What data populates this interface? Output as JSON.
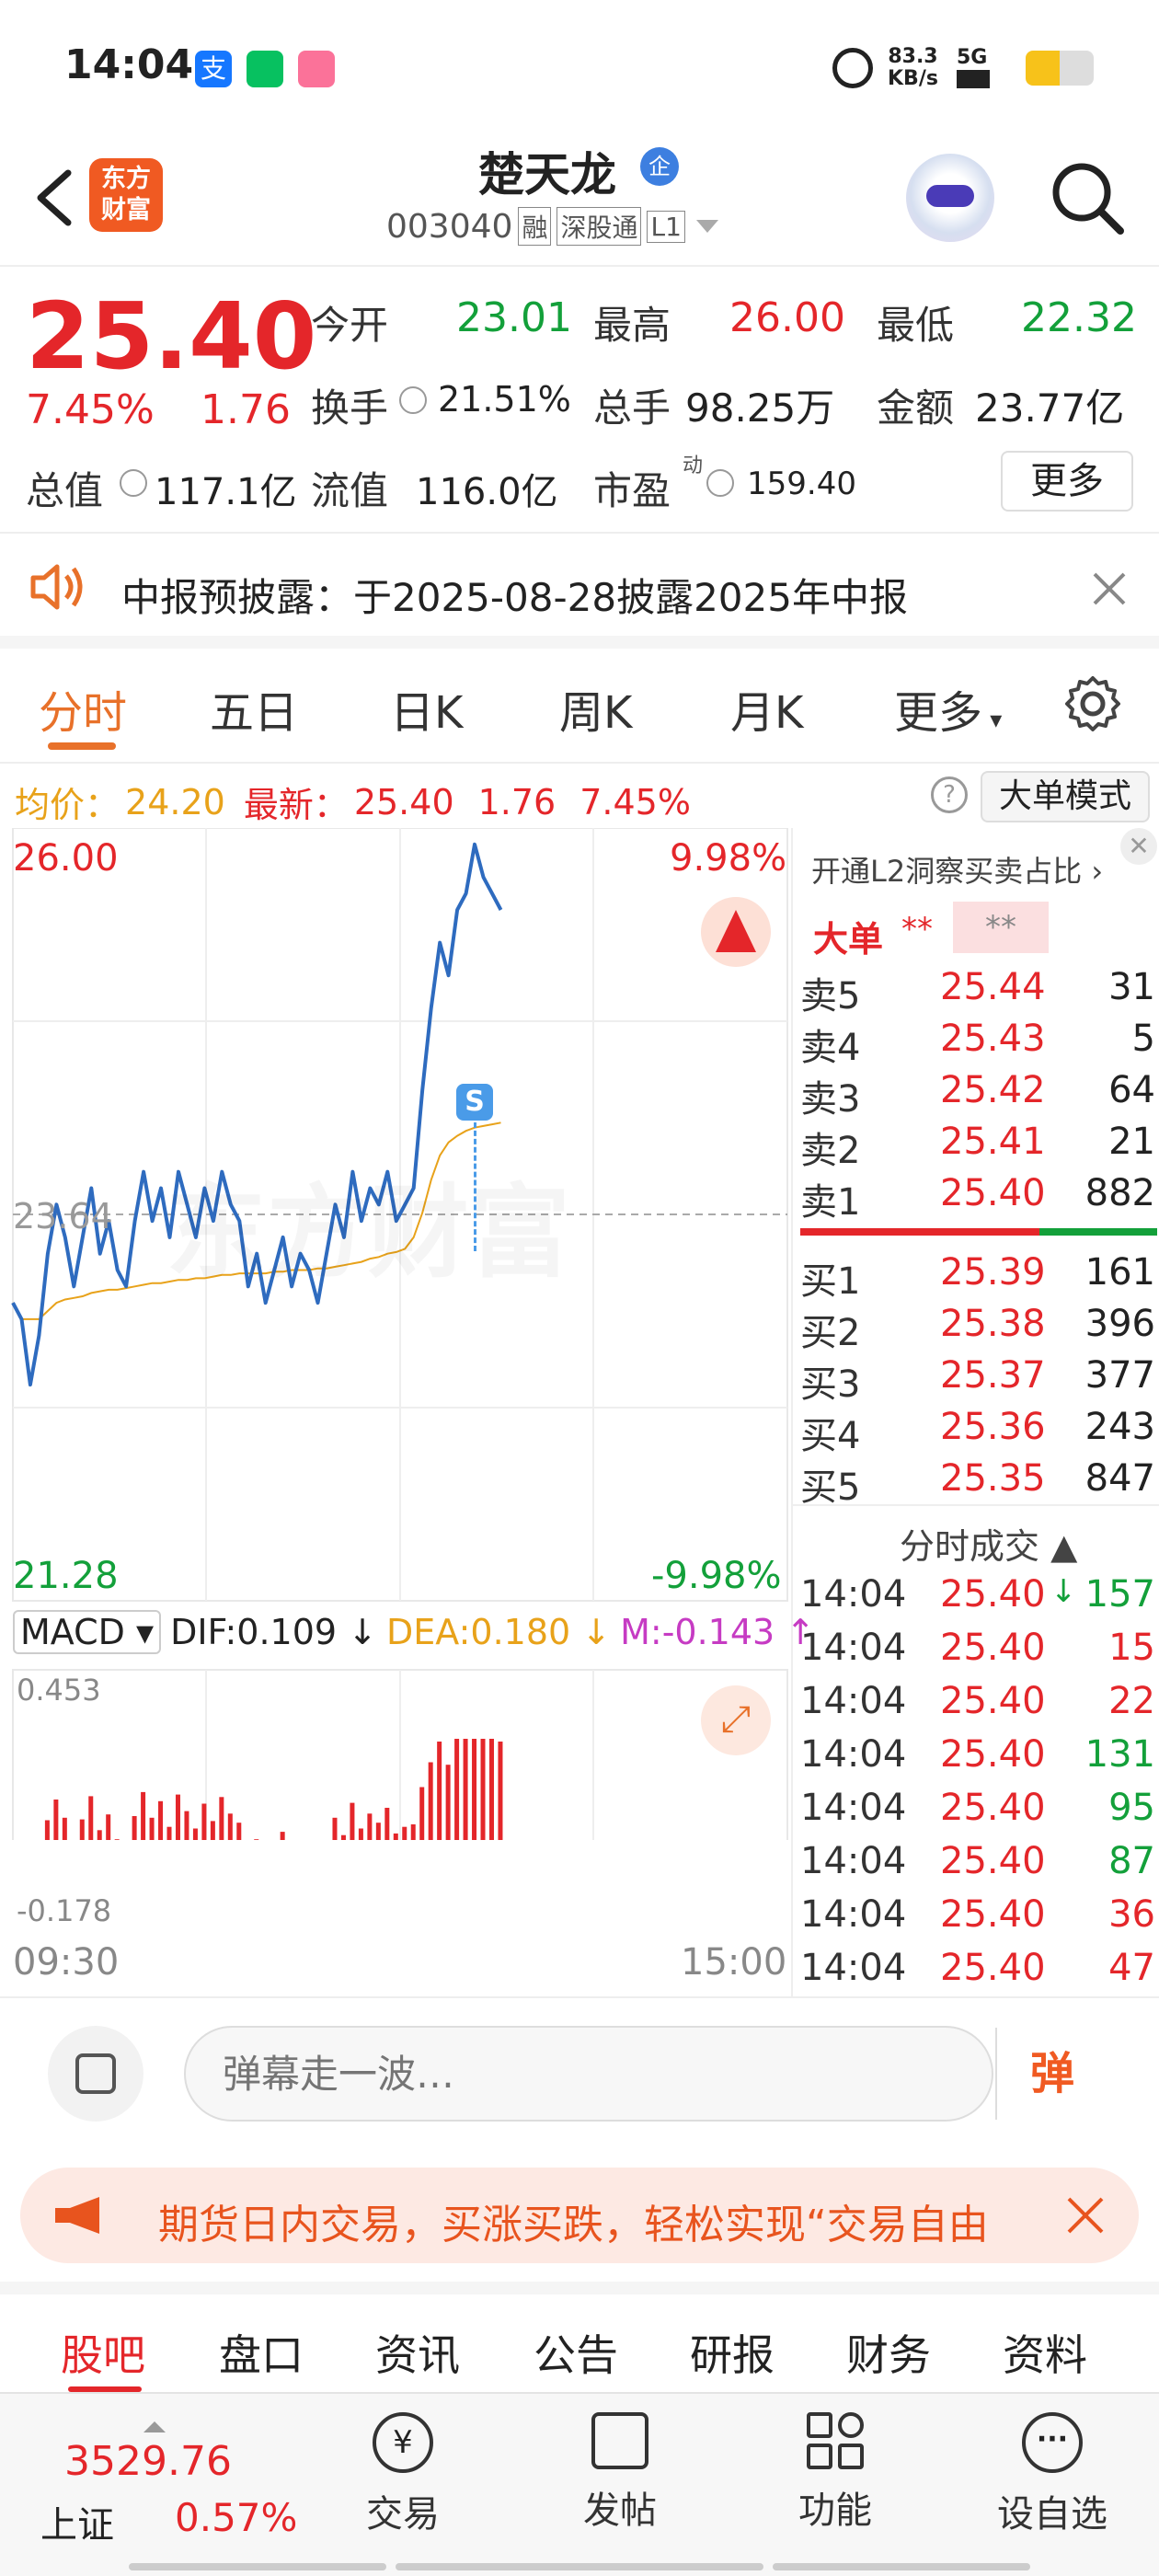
{
  "status": {
    "time": "14:04",
    "speed": "83.3",
    "speed_unit": "KB/s",
    "network": "5G"
  },
  "header": {
    "title": "楚天龙",
    "code": "003040",
    "tag_rong": "融",
    "tag_sgt": "深股通",
    "tag_level": "L1",
    "logo_line1": "东方",
    "logo_line2": "财富",
    "verified_label": "企"
  },
  "quote": {
    "price": "25.40",
    "pct": "7.45%",
    "chg": "1.76",
    "open_label": "今开",
    "open": "23.01",
    "high_label": "最高",
    "high": "26.00",
    "low_label": "最低",
    "low": "22.32",
    "turnover_label": "换手",
    "turnover": "21.51%",
    "volume_label": "总手",
    "volume": "98.25万",
    "amount_label": "金额",
    "amount": "23.77亿",
    "mcap_label": "总值",
    "mcap": "117.1亿",
    "float_label": "流值",
    "float": "116.0亿",
    "pe_label": "市盈",
    "pe_sup": "动",
    "pe": "159.40",
    "more": "更多"
  },
  "notice": {
    "text": "中报预披露：于2025-08-28披露2025年中报"
  },
  "tabs": [
    "分时",
    "五日",
    "日K",
    "周K",
    "月K",
    "更多"
  ],
  "chart_header": {
    "avg_label": "均价：",
    "avg": "24.20",
    "last_label": "最新：",
    "last": "25.40",
    "chg": "1.76",
    "pct": "7.45%",
    "mode_btn": "大单模式"
  },
  "chart_data": {
    "type": "line",
    "y_top": "26.00",
    "y_bottom": "21.28",
    "y_ref": "23.64",
    "pct_top": "9.98%",
    "pct_bottom": "-9.98%",
    "x_start": "09:30",
    "x_end": "15:00",
    "ylim": [
      21.28,
      26.0
    ],
    "price": [
      23.1,
      23.0,
      22.6,
      22.9,
      23.4,
      23.7,
      23.5,
      23.2,
      23.5,
      23.8,
      23.4,
      23.6,
      23.3,
      23.2,
      23.6,
      23.9,
      23.6,
      23.8,
      23.5,
      23.9,
      23.7,
      23.5,
      23.8,
      23.6,
      23.9,
      23.7,
      23.6,
      23.2,
      23.4,
      23.1,
      23.3,
      23.5,
      23.2,
      23.4,
      23.3,
      23.1,
      23.4,
      23.7,
      23.5,
      23.9,
      23.6,
      23.8,
      23.7,
      23.9,
      23.6,
      23.7,
      23.8,
      24.4,
      24.9,
      25.3,
      25.1,
      25.5,
      25.6,
      25.9,
      25.7,
      25.6,
      25.5
    ],
    "avg": [
      23.1,
      23.0,
      23.0,
      23.0,
      23.05,
      23.1,
      23.12,
      23.13,
      23.14,
      23.16,
      23.17,
      23.18,
      23.18,
      23.19,
      23.2,
      23.21,
      23.22,
      23.22,
      23.23,
      23.24,
      23.24,
      23.25,
      23.25,
      23.26,
      23.27,
      23.27,
      23.28,
      23.28,
      23.28,
      23.28,
      23.29,
      23.29,
      23.3,
      23.3,
      23.3,
      23.31,
      23.31,
      23.32,
      23.33,
      23.34,
      23.35,
      23.37,
      23.38,
      23.4,
      23.41,
      23.43,
      23.5,
      23.65,
      23.85,
      24.0,
      24.08,
      24.12,
      24.15,
      24.17,
      24.18,
      24.19,
      24.2
    ],
    "macd": {
      "label": "MACD",
      "dif_label": "DIF:",
      "dif": "0.109",
      "dea_label": "DEA:",
      "dea": "0.180",
      "m_label": "M:",
      "m": "-0.143",
      "y_top": "0.453",
      "y_bottom": "-0.178"
    }
  },
  "orderbook": {
    "l2_title": "开通L2洞察买卖占比",
    "big_label": "大单",
    "big_val1": "**",
    "big_val2": "**",
    "asks": [
      {
        "label": "卖5",
        "price": "25.44",
        "vol": "31"
      },
      {
        "label": "卖4",
        "price": "25.43",
        "vol": "5"
      },
      {
        "label": "卖3",
        "price": "25.42",
        "vol": "64"
      },
      {
        "label": "卖2",
        "price": "25.41",
        "vol": "21"
      },
      {
        "label": "卖1",
        "price": "25.40",
        "vol": "882"
      }
    ],
    "bids": [
      {
        "label": "买1",
        "price": "25.39",
        "vol": "161"
      },
      {
        "label": "买2",
        "price": "25.38",
        "vol": "396"
      },
      {
        "label": "买3",
        "price": "25.37",
        "vol": "377"
      },
      {
        "label": "买4",
        "price": "25.36",
        "vol": "243"
      },
      {
        "label": "买5",
        "price": "25.35",
        "vol": "847"
      }
    ],
    "ticks_title": "分时成交",
    "ticks": [
      {
        "time": "14:04",
        "price": "25.40",
        "vol": "157",
        "arrow": "↓"
      },
      {
        "time": "14:04",
        "price": "25.40",
        "vol": "15"
      },
      {
        "time": "14:04",
        "price": "25.40",
        "vol": "22"
      },
      {
        "time": "14:04",
        "price": "25.40",
        "vol": "131"
      },
      {
        "time": "14:04",
        "price": "25.40",
        "vol": "95"
      },
      {
        "time": "14:04",
        "price": "25.40",
        "vol": "87"
      },
      {
        "time": "14:04",
        "price": "25.40",
        "vol": "36"
      },
      {
        "time": "14:04",
        "price": "25.40",
        "vol": "47"
      }
    ]
  },
  "comment": {
    "placeholder": "弹幕走一波…",
    "send": "弹"
  },
  "ad": {
    "text": "期货日内交易，买涨买跌，轻松实现“交易自由"
  },
  "subtabs": [
    "股吧",
    "盘口",
    "资讯",
    "公告",
    "研报",
    "财务",
    "资料"
  ],
  "footer": {
    "index_value": "3529.76",
    "index_name": "上证",
    "index_pct": "0.57%",
    "trade": "交易",
    "post": "发帖",
    "func": "功能",
    "watch": "设自选"
  }
}
